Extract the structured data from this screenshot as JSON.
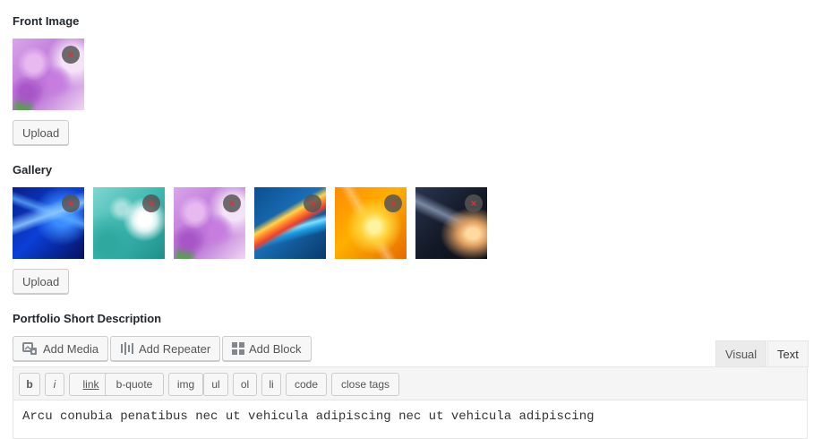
{
  "front_image": {
    "label": "Front Image",
    "remove_glyph": "×",
    "upload_label": "Upload"
  },
  "gallery": {
    "label": "Gallery",
    "items": [
      {
        "image": "blue-light-streaks",
        "remove_glyph": "×"
      },
      {
        "image": "dandelion",
        "remove_glyph": "×"
      },
      {
        "image": "purple-flowers",
        "remove_glyph": "×"
      },
      {
        "image": "colorful-swirl",
        "remove_glyph": "×"
      },
      {
        "image": "orange-abstract",
        "remove_glyph": "×"
      },
      {
        "image": "dark-light-beam",
        "remove_glyph": "×"
      }
    ],
    "upload_label": "Upload"
  },
  "description": {
    "label": "Portfolio Short Description",
    "media_buttons": [
      {
        "label": "Add Media",
        "icon": "add-media-icon"
      },
      {
        "label": "Add Repeater",
        "icon": "repeater-icon"
      },
      {
        "label": "Add Block",
        "icon": "block-grid-icon"
      }
    ],
    "tabs": {
      "visual": "Visual",
      "text": "Text",
      "active": "Text"
    },
    "quicktags": [
      "b",
      "i",
      "link",
      "b-quote",
      "img",
      "ul",
      "ol",
      "li",
      "code",
      "close tags"
    ],
    "content": "Arcu conubia penatibus nec ut vehicula adipiscing nec ut vehicula adipiscing"
  }
}
